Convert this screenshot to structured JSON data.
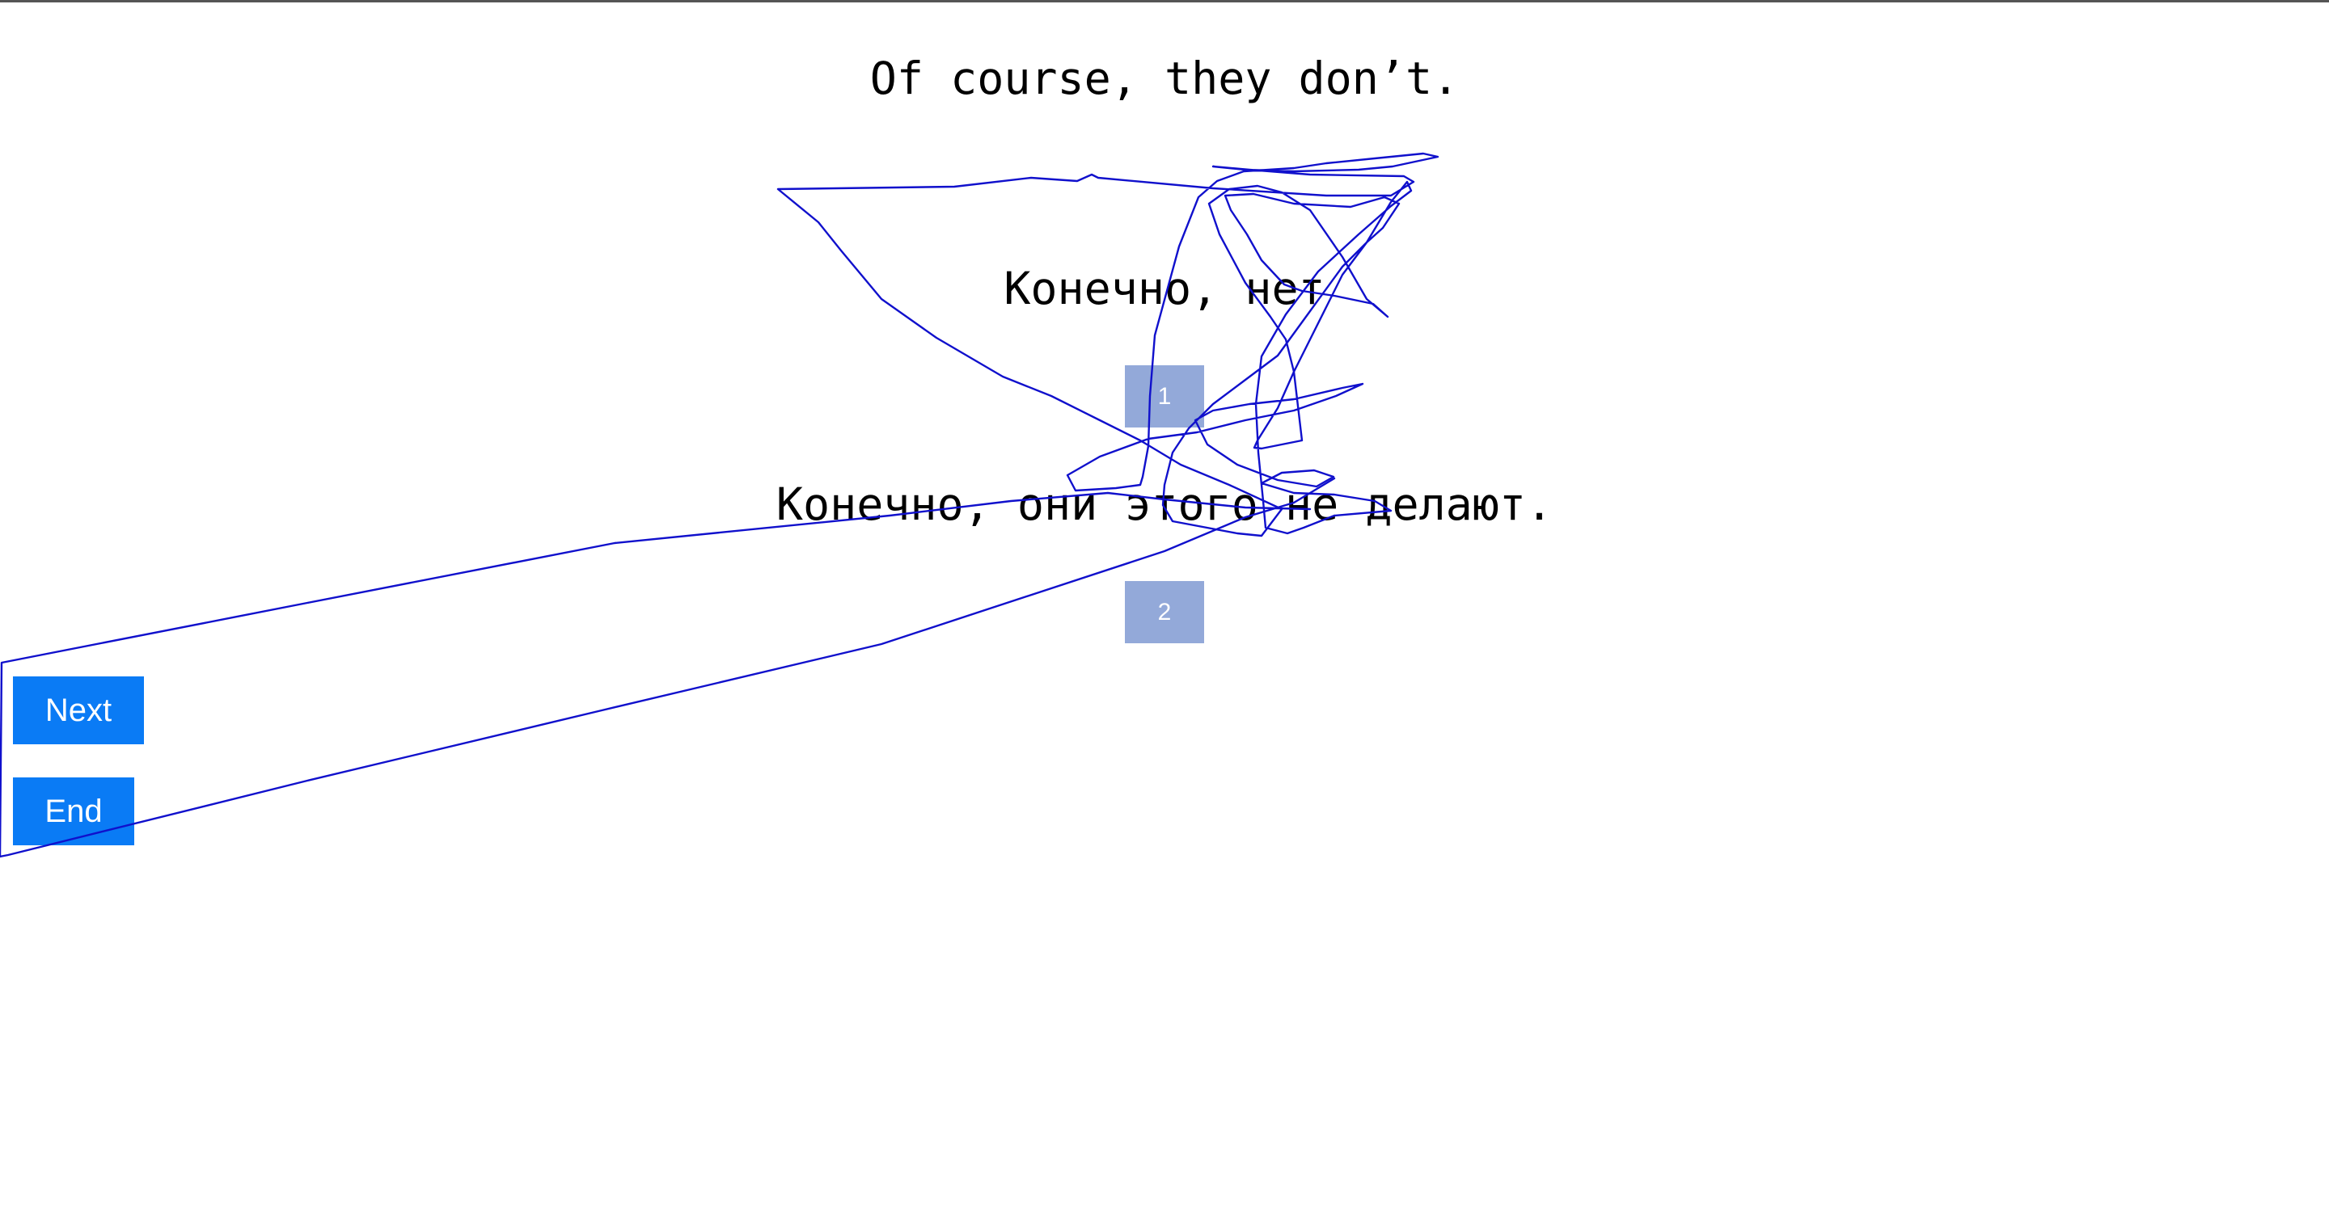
{
  "source_sentence": "Of course, they don’t.",
  "options": [
    {
      "text": "Конечно, нет",
      "choice_label": "1"
    },
    {
      "text": "Конечно, они этого не делают.",
      "choice_label": "2"
    }
  ],
  "buttons": {
    "next_label": "Next",
    "end_label": "End"
  },
  "colors": {
    "nav_button": "#0a7bf5",
    "choice_button": "#93a9d9",
    "scribble_stroke": "#1010cc"
  }
}
